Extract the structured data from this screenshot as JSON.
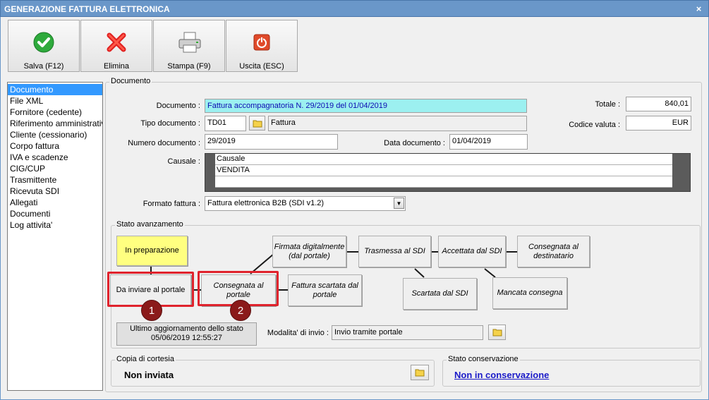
{
  "window": {
    "title": "GENERAZIONE FATTURA ELETTRONICA",
    "close": "×"
  },
  "toolbar": {
    "save": "Salva (F12)",
    "delete": "Elimina",
    "print": "Stampa (F9)",
    "exit": "Uscita (ESC)"
  },
  "nav": {
    "items": [
      "Documento",
      "File XML",
      "Fornitore (cedente)",
      "Riferimento amministrativo",
      "Cliente (cessionario)",
      "Corpo fattura",
      "IVA e scadenze",
      "CIG/CUP",
      "Trasmittente",
      "Ricevuta SDI",
      "Allegati",
      "Documenti",
      "Log attivita'"
    ],
    "selected": "Documento"
  },
  "documento": {
    "legend": "Documento",
    "doc_label": "Documento :",
    "doc_value": "Fattura accompagnatoria N. 29/2019 del 01/04/2019",
    "tipo_label": "Tipo documento :",
    "tipo_code": "TD01",
    "tipo_desc": "Fattura",
    "numero_label": "Numero documento :",
    "numero_value": "29/2019",
    "data_label": "Data documento :",
    "data_value": "01/04/2019",
    "totale_label": "Totale :",
    "totale_value": "840,01",
    "valuta_label": "Codice valuta :",
    "valuta_value": "EUR",
    "causale_label": "Causale :",
    "causale_header": "Causale",
    "causale_rows": [
      "VENDITA"
    ],
    "formato_label": "Formato fattura :",
    "formato_value": "Fattura elettronica B2B (SDI v1.2)"
  },
  "stato": {
    "legend": "Stato avanzamento",
    "in_preparazione": "In preparazione",
    "da_inviare": "Da inviare al portale",
    "consegnata_portale": "Consegnata al portale",
    "firmata": "Firmata digitalmente (dal portale)",
    "scartata_portale": "Fattura scartata dal portale",
    "trasmessa": "Trasmessa al SDI",
    "scartata_sdi": "Scartata dal SDI",
    "accettata": "Accettata dal SDI",
    "mancata": "Mancata consegna",
    "consegnata_dest": "Consegnata al destinatario",
    "badge1": "1",
    "badge2": "2",
    "ultimo_line1": "Ultimo aggiornamento dello stato",
    "ultimo_line2": "05/06/2019 12:55:27",
    "modalita_label": "Modalita' di invio :",
    "modalita_value": "Invio tramite portale"
  },
  "cortesia": {
    "legend": "Copia di cortesia",
    "value": "Non inviata"
  },
  "conservazione": {
    "legend": "Stato conservazione",
    "value": "Non in conservazione"
  },
  "colors": {
    "accent": "#3399ff",
    "yellow": "#ffff80",
    "red": "#e0232d",
    "badge": "#8b1a1a",
    "link": "#1a1ac8"
  }
}
